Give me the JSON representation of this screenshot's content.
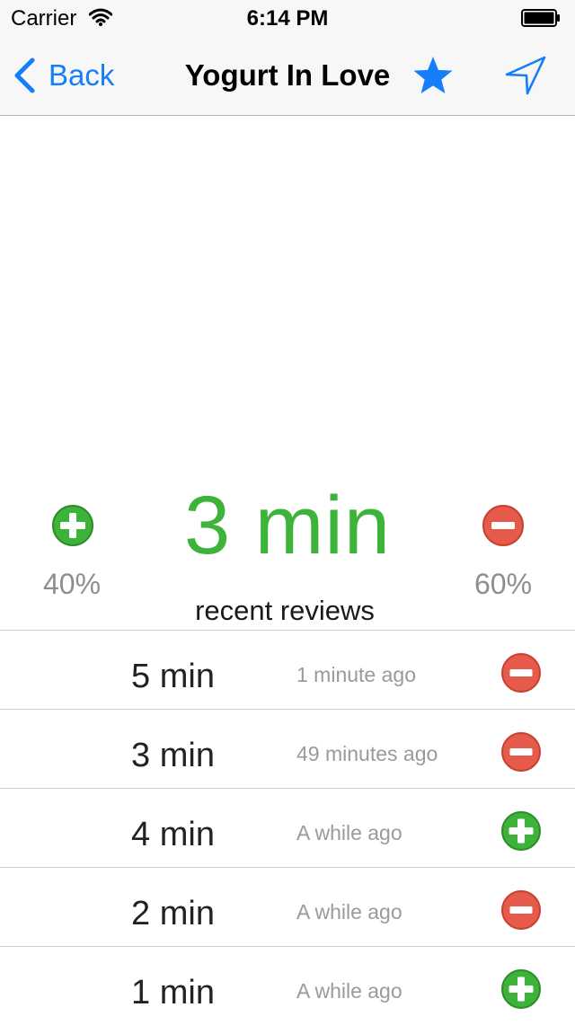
{
  "status_bar": {
    "carrier": "Carrier",
    "time": "6:14 PM"
  },
  "nav": {
    "back_label": "Back",
    "title": "Yogurt In Love",
    "accent_color": "#147efb"
  },
  "summary": {
    "wait_time": "3 min",
    "positive_percent": "40%",
    "negative_percent": "60%",
    "recent_label": "recent reviews",
    "positive_color": "#3db33a",
    "negative_color": "#e55a4a"
  },
  "reviews": [
    {
      "duration": "5 min",
      "when": "1 minute ago",
      "vote": "minus"
    },
    {
      "duration": "3 min",
      "when": "49 minutes ago",
      "vote": "minus"
    },
    {
      "duration": "4 min",
      "when": "A while ago",
      "vote": "plus"
    },
    {
      "duration": "2 min",
      "when": "A while ago",
      "vote": "minus"
    },
    {
      "duration": "1 min",
      "when": "A while ago",
      "vote": "plus"
    }
  ],
  "icons": {
    "back": "chevron-left-icon",
    "favorite": "star-icon",
    "locate": "location-arrow-icon",
    "positive": "plus-circle-icon",
    "negative": "minus-circle-icon"
  }
}
